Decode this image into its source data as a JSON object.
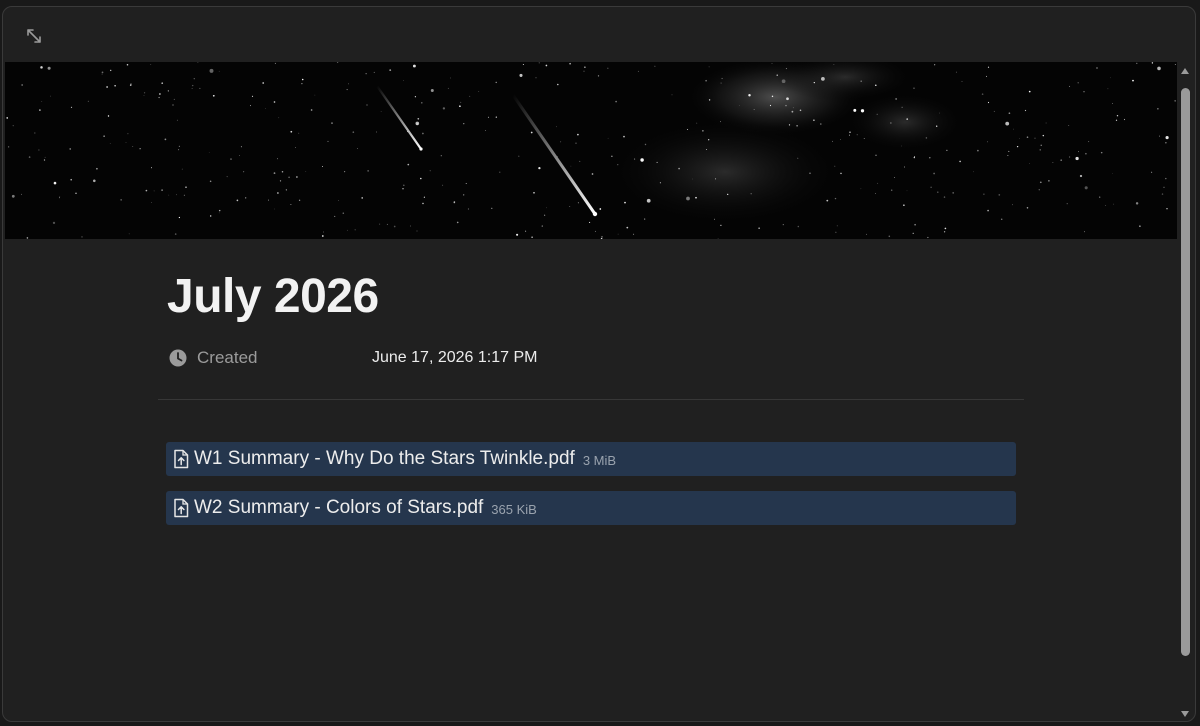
{
  "toolbar": {
    "expand_icon": "expand-arrows-icon"
  },
  "cover": {
    "description_icon": "cover-image"
  },
  "page": {
    "title": "July 2026",
    "properties": [
      {
        "icon": "clock-icon",
        "label": "Created",
        "value": "June 17, 2026 1:17 PM"
      }
    ],
    "files": [
      {
        "icon": "file-upload-icon",
        "name": "W1 Summary - Why Do the Stars Twinkle.pdf",
        "size": "3 MiB"
      },
      {
        "icon": "file-upload-icon",
        "name": "W2 Summary - Colors of Stars.pdf",
        "size": "365 KiB"
      }
    ]
  },
  "colors": {
    "background": "#202020",
    "file_block": "#25364d",
    "muted_text": "#9b9b9b"
  }
}
